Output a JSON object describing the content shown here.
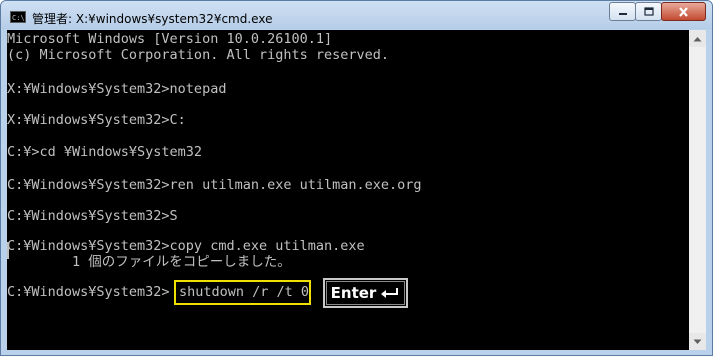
{
  "window": {
    "title": "管理者: X:¥windows¥system32¥cmd.exe",
    "icon_label": "C:\\"
  },
  "console": {
    "lines": [
      "Microsoft Windows [Version 10.0.26100.1]",
      "(c) Microsoft Corporation. All rights reserved.",
      "X:¥Windows¥System32>notepad",
      "X:¥Windows¥System32>C:",
      "C:¥>cd ¥Windows¥System32",
      "C:¥Windows¥System32>ren utilman.exe utilman.exe.org",
      "C:¥Windows¥System32>S",
      "C:¥Windows¥System32>copy cmd.exe utilman.exe",
      "        1 個のファイルをコピーしました。",
      "C:¥Windows¥System32>"
    ],
    "highlighted_command": "shutdown /r /t 0",
    "enter_key_label": "Enter"
  },
  "colors": {
    "console_bg": "#000000",
    "console_text": "#c0c0c0",
    "highlight_border": "#f0e000"
  },
  "icons": [
    "cmd-app-icon",
    "minimize-icon",
    "maximize-icon",
    "close-icon",
    "scroll-up-icon",
    "scroll-down-icon",
    "enter-return-icon"
  ]
}
